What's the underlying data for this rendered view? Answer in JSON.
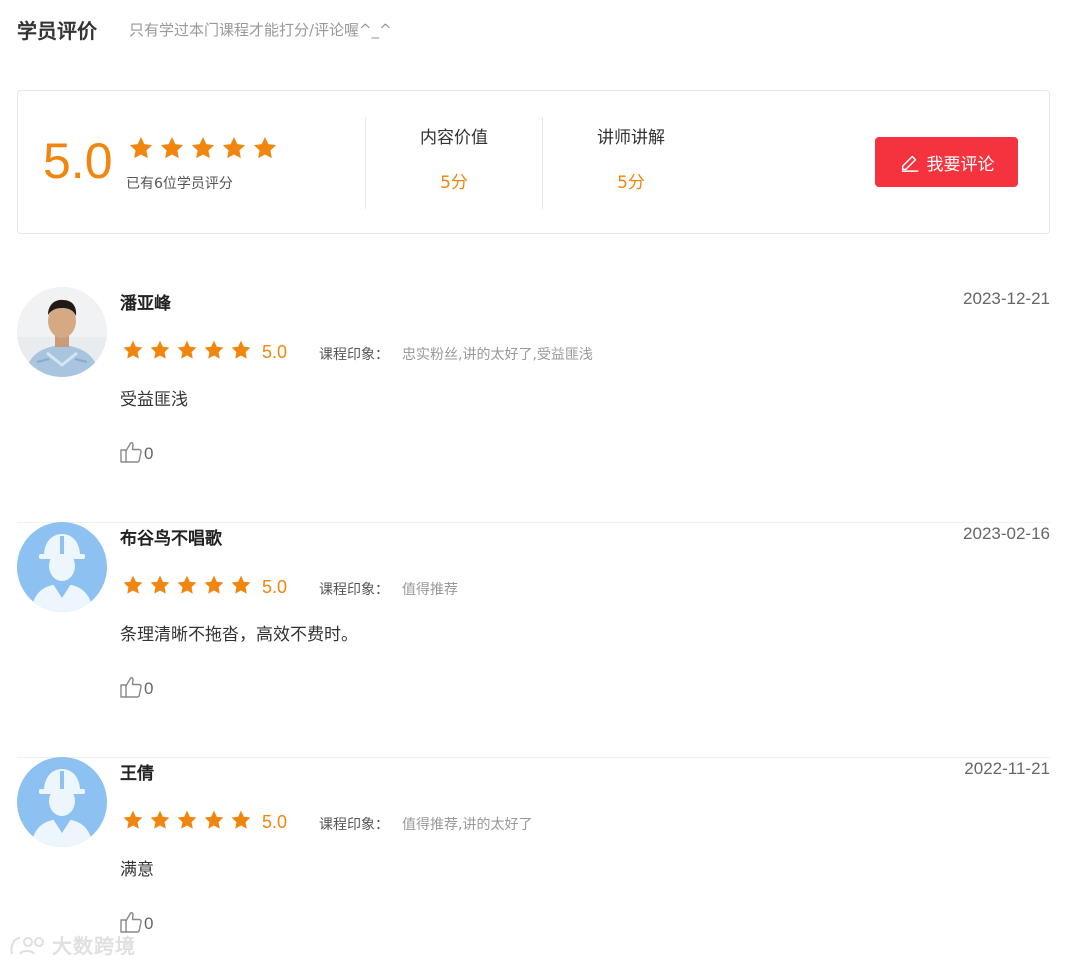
{
  "header": {
    "title": "学员评价",
    "subtitle": "只有学过本门课程才能打分/评论喔^_^"
  },
  "summary": {
    "score": "5.0",
    "star_count": 5,
    "raters_text": "已有6位学员评分",
    "metrics": [
      {
        "label": "内容价值",
        "value": "5分"
      },
      {
        "label": "讲师讲解",
        "value": "5分"
      }
    ],
    "write_button_label": "我要评论"
  },
  "reviews": [
    {
      "name": "潘亚峰",
      "date": "2023-12-21",
      "score": "5.0",
      "impression_label": "课程印象：",
      "impression": "忠实粉丝,讲的太好了,受益匪浅",
      "text": "受益匪浅",
      "likes": "0",
      "avatar": "photo-avatar"
    },
    {
      "name": "布谷鸟不唱歌",
      "date": "2023-02-16",
      "score": "5.0",
      "impression_label": "课程印象：",
      "impression": "值得推荐",
      "text": "条理清晰不拖沓，高效不费时。",
      "likes": "0",
      "avatar": "default-worker-avatar"
    },
    {
      "name": "王倩",
      "date": "2022-11-21",
      "score": "5.0",
      "impression_label": "课程印象：",
      "impression": "值得推荐,讲的太好了",
      "text": "满意",
      "likes": "0",
      "avatar": "default-worker-avatar"
    }
  ],
  "watermark": {
    "text": "大数跨境"
  },
  "colors": {
    "accent_orange": "#f0860e",
    "button_red": "#f5333f",
    "avatar_blue": "#8cc1f2"
  }
}
